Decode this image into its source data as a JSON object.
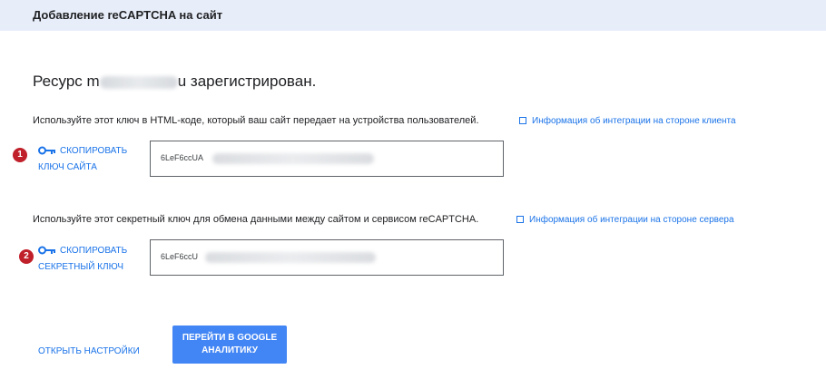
{
  "header": {
    "title": "Добавление reCAPTCHA на сайт"
  },
  "resource": {
    "prefix": "Ресурс ",
    "domain_visible_start": "m",
    "domain_visible_end": "u",
    "suffix": " зарегистрирован."
  },
  "site_key": {
    "description": "Используйте этот ключ в HTML-коде, который ваш сайт передает на устройства пользователей.",
    "info_link": "Информация об интеграции на стороне клиента",
    "badge": "1",
    "copy_line1": "СКОПИРОВАТЬ",
    "copy_line2": "КЛЮЧ САЙТА",
    "value_prefix": "6LeF6ccUA"
  },
  "secret_key": {
    "description": "Используйте этот секретный ключ для обмена данными между сайтом и сервисом reCAPTCHA.",
    "info_link": "Информация об интеграции на стороне сервера",
    "badge": "2",
    "copy_line1": "СКОПИРОВАТЬ",
    "copy_line2": "СЕКРЕТНЫЙ КЛЮЧ",
    "value_prefix": "6LeF6ccU"
  },
  "actions": {
    "settings_link": "ОТКРЫТЬ НАСТРОЙКИ",
    "analytics_button": "ПЕРЕЙТИ В GOOGLE АНАЛИТИКУ"
  },
  "colors": {
    "header_bg": "#e8eef9",
    "accent": "#1a73e8",
    "button": "#4285f4",
    "badge": "#c0202a"
  }
}
